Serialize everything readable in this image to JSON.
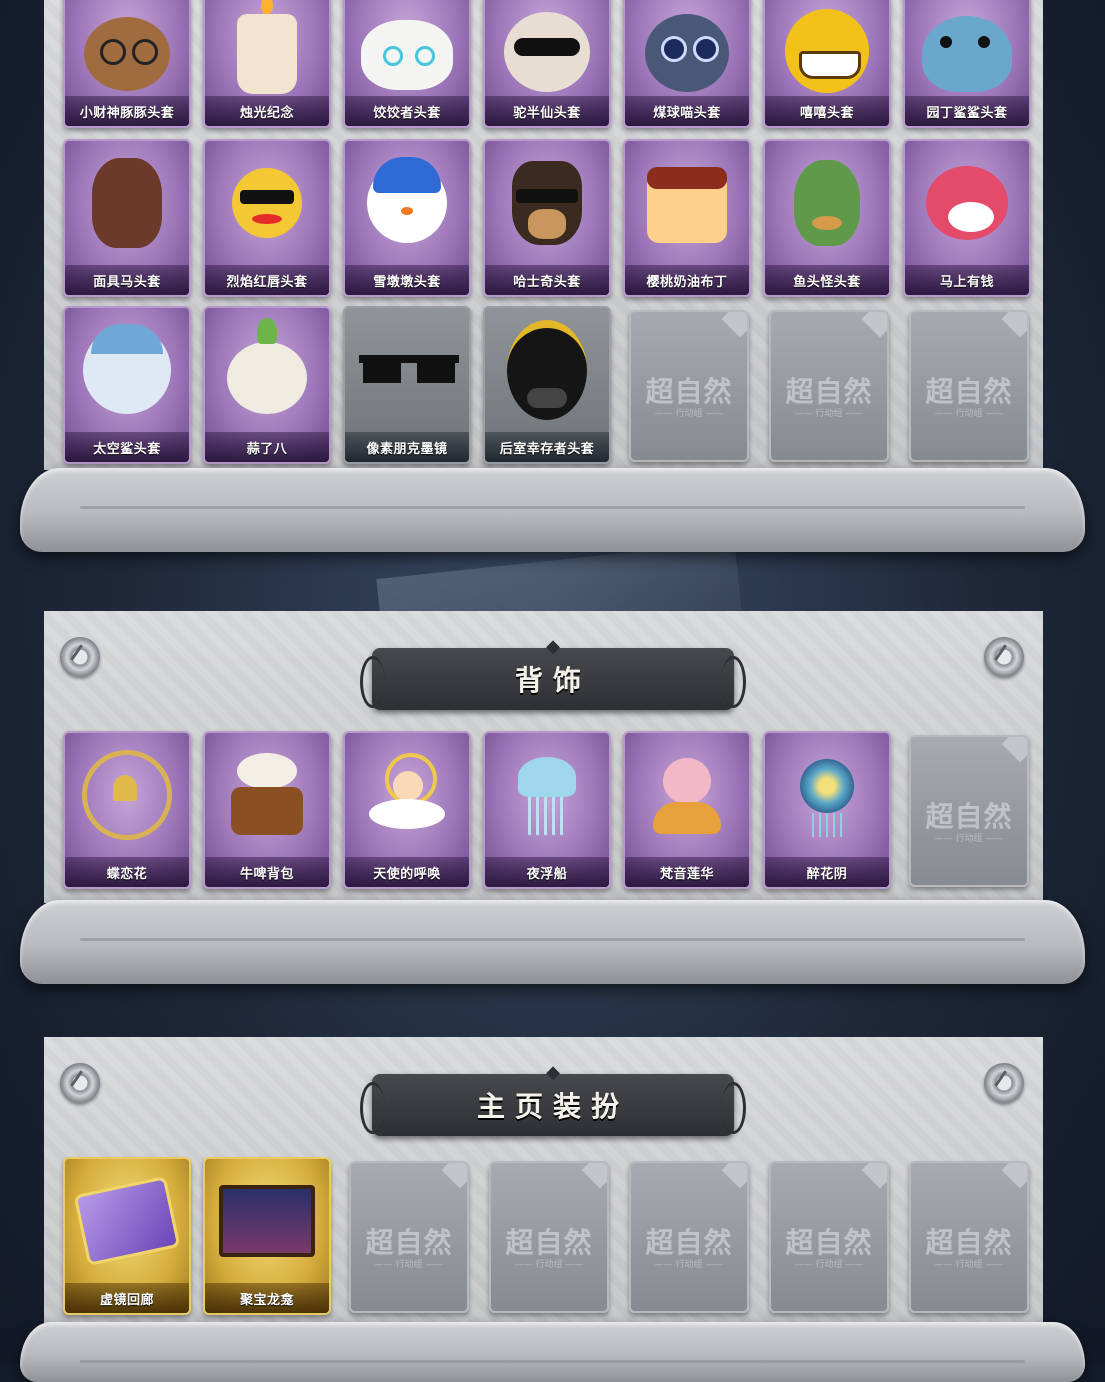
{
  "sections": {
    "headwear": {
      "items": [
        {
          "label": "小财神豚豚头套"
        },
        {
          "label": "烛光纪念"
        },
        {
          "label": "饺饺者头套"
        },
        {
          "label": "驼半仙头套"
        },
        {
          "label": "煤球喵头套"
        },
        {
          "label": "嘻嘻头套"
        },
        {
          "label": "园丁鲨鲨头套"
        },
        {
          "label": "面具马头套"
        },
        {
          "label": "烈焰红唇头套"
        },
        {
          "label": "雪墩墩头套"
        },
        {
          "label": "哈士奇头套"
        },
        {
          "label": "樱桃奶油布丁"
        },
        {
          "label": "鱼头怪头套"
        },
        {
          "label": "马上有钱"
        },
        {
          "label": "太空鲨头套"
        },
        {
          "label": "蒜了八"
        },
        {
          "label": "像素朋克墨镜"
        },
        {
          "label": "后室幸存者头套"
        }
      ]
    },
    "back": {
      "title": "背饰",
      "items": [
        {
          "label": "蝶恋花"
        },
        {
          "label": "牛啤背包"
        },
        {
          "label": "天使的呼唤"
        },
        {
          "label": "夜浮船"
        },
        {
          "label": "梵音莲华"
        },
        {
          "label": "醉花阴"
        }
      ]
    },
    "homepage": {
      "title": "主页装扮",
      "items": [
        {
          "label": "虚镜回廊"
        },
        {
          "label": "聚宝龙龛"
        }
      ]
    }
  },
  "placeholder": {
    "mark": "超自然",
    "sub": "—— 行动组 ——"
  }
}
